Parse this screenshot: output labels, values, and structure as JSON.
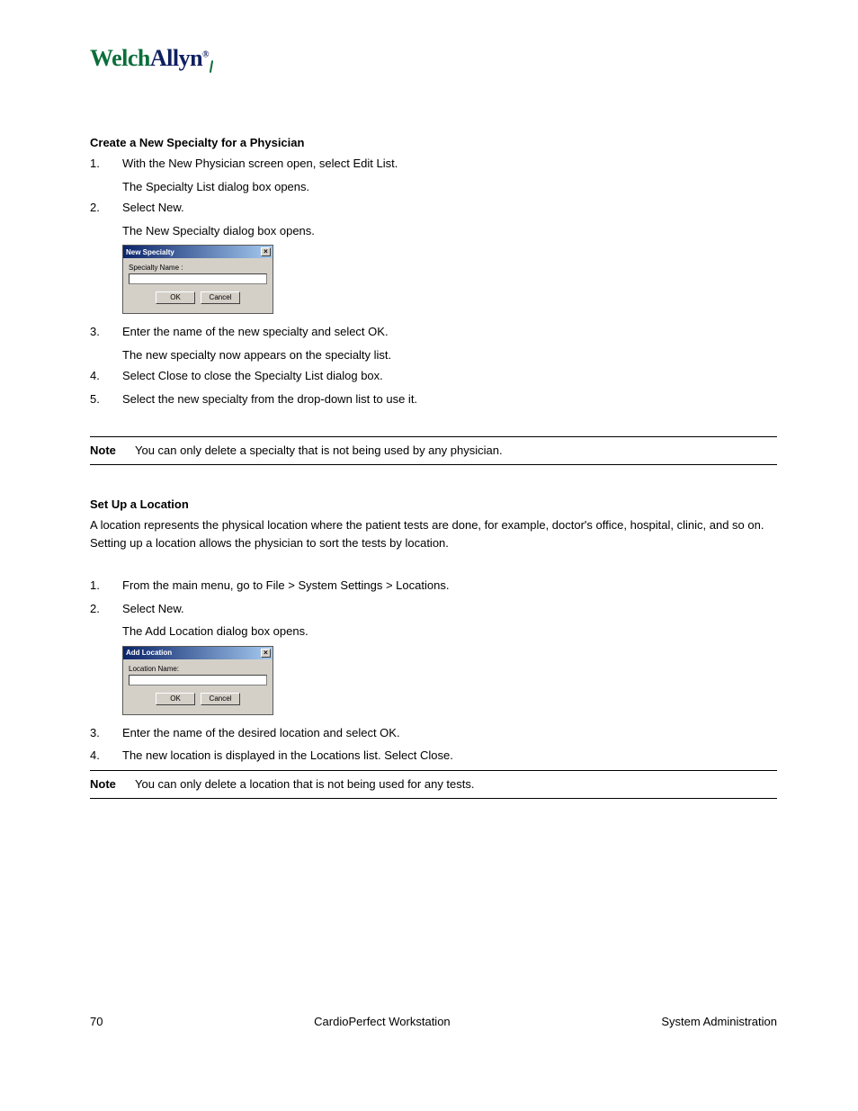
{
  "logo": {
    "part1": "Welch",
    "part2": "Allyn",
    "reg": "®"
  },
  "spec": {
    "heading": "Create a New Specialty for a Physician",
    "step1_num": "1.",
    "step1_txt": "With the New Physician screen open, select Edit List.",
    "indent1": "The Specialty List dialog box opens.",
    "step2_num": "2.",
    "step2_txt": "Select New.",
    "indent2": "The New Specialty dialog box opens.",
    "dialog_title": "New Specialty",
    "dialog_label": "Specialty Name :",
    "ok": "OK",
    "cancel": "Cancel",
    "step3_num": "3.",
    "step3_txt": "Enter the name of the new specialty and select OK.",
    "indent3": "The new specialty now appears on the specialty list.",
    "step4_num": "4.",
    "step4_txt": "Select Close to close the Specialty List dialog box.",
    "step5_num": "5.",
    "step5_txt": "Select the new specialty from the drop-down list to use it.",
    "note_label": "Note",
    "note_text": "You can only delete a specialty that is not being used by any physician."
  },
  "loc": {
    "heading": "Set Up a Location",
    "intro": "A location represents the physical location where the patient tests are done, for example, doctor's office, hospital, clinic, and so on. Setting up a location allows the physician to sort the tests by location.",
    "step1_num": "1.",
    "step1_txt": "From the main menu, go to File > System Settings > Locations.",
    "step2_num": "2.",
    "step2_txt": "Select New.",
    "indent2": "The Add Location dialog box opens.",
    "dialog_title": "Add Location",
    "dialog_label": "Location Name:",
    "ok": "OK",
    "cancel": "Cancel",
    "step3_num": "3.",
    "step3_txt": "Enter the name of the desired location and select OK.",
    "step4_num": "4.",
    "step4_txt": "The new location is displayed in the Locations list. Select Close.",
    "note_label": "Note",
    "note_text": "You can only delete a location that is not being used for any tests."
  },
  "footer": {
    "left": "70",
    "center": "CardioPerfect Workstation",
    "right": "System Administration"
  }
}
